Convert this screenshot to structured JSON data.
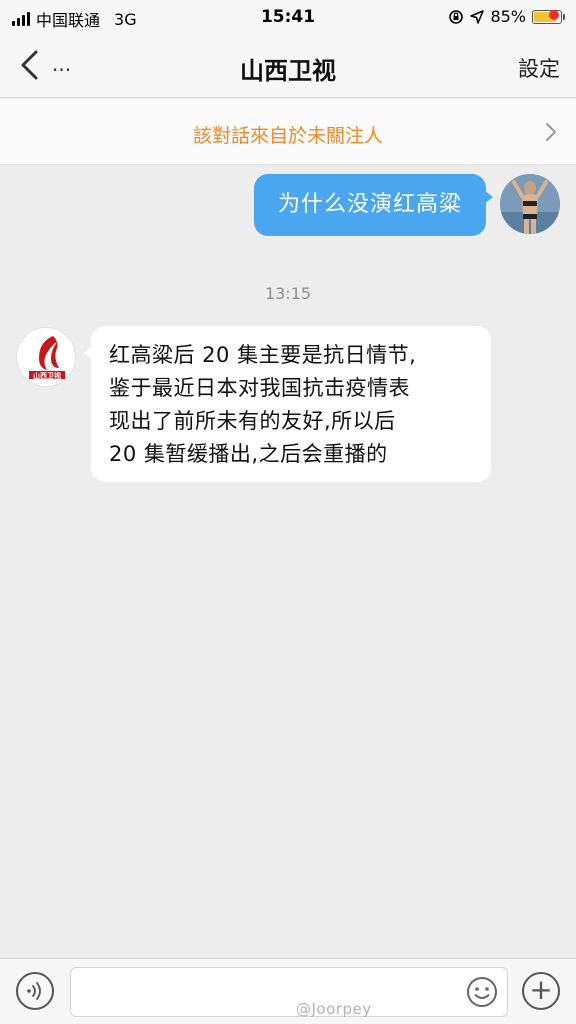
{
  "status_bar": {
    "carrier": "中国联通",
    "network": "3G",
    "time": "15:41",
    "battery_percent_label": "85%",
    "battery_level": 0.85
  },
  "nav": {
    "title": "山西卫视",
    "more_label": "...",
    "settings_label": "設定"
  },
  "notice": {
    "text": "該對話來自於未關注人"
  },
  "messages": [
    {
      "direction": "outgoing",
      "text": "为什么没演红高粱"
    },
    {
      "direction": "timestamp",
      "text": "13:15"
    },
    {
      "direction": "incoming",
      "lines": [
        "红高粱后 20 集主要是抗日情节,",
        "鉴于最近日本对我国抗击疫情表",
        "现出了前所未有的友好,所以后",
        "20 集暂缓播出,之后会重播的"
      ]
    }
  ],
  "input_bar": {
    "placeholder": ""
  },
  "watermark": "@Joorpey",
  "colors": {
    "accent_blue": "#4aa7ef",
    "notice_orange": "#f08a24",
    "badge_red": "#e8332a"
  },
  "icons": [
    "back-chevron-icon",
    "location-icon",
    "battery-icon",
    "chevron-right-icon",
    "voice-icon",
    "emoji-icon",
    "plus-icon"
  ]
}
